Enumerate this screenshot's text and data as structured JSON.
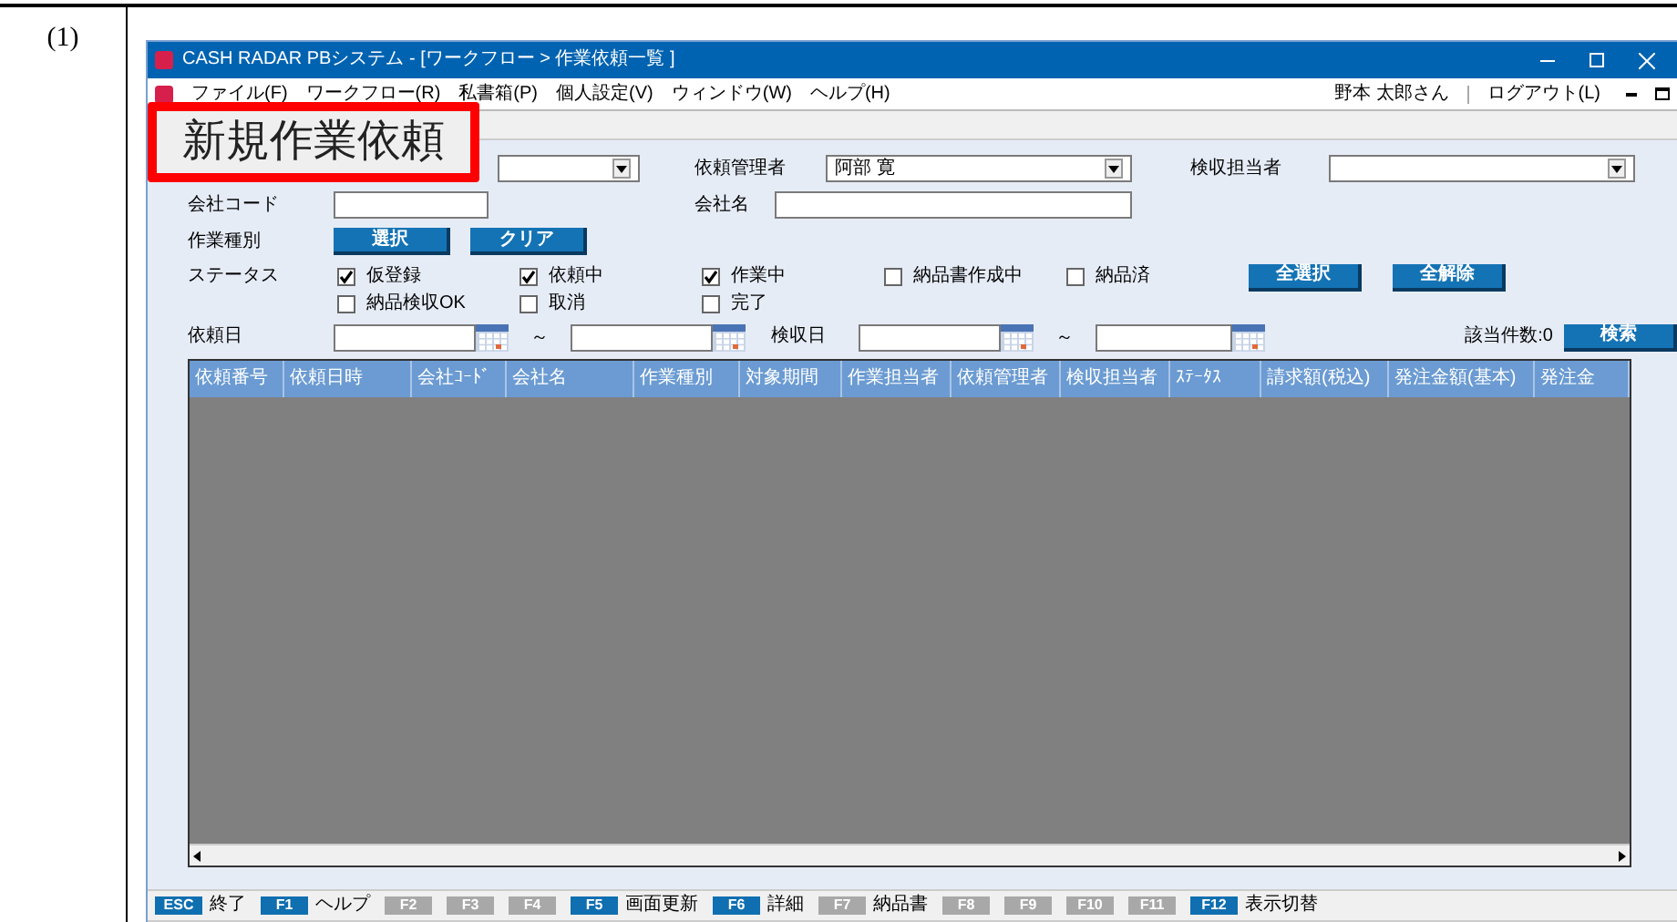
{
  "item_number": "(1)",
  "window": {
    "title": "CASH RADAR PBシステム - [ワークフロー > 作業依頼一覧 ]"
  },
  "menu": [
    {
      "label": "ファイル(F)"
    },
    {
      "label": "ワークフロー(R)"
    },
    {
      "label": "私書箱(P)"
    },
    {
      "label": "個人設定(V)"
    },
    {
      "label": "ウィンドウ(W)"
    },
    {
      "label": "ヘルプ(H)"
    }
  ],
  "user": {
    "name": "野本 太郎さん",
    "logout": "ログアウト(L)"
  },
  "callout": "新規作業依頼",
  "filters": {
    "manager_label": "依頼管理者",
    "manager_value": "阿部 寛",
    "inspector_label": "検収担当者",
    "company_code_label": "会社コード",
    "company_name_label": "会社名",
    "work_type_label": "作業種別",
    "select_button": "選択",
    "clear_button": "クリア",
    "status_label": "ステータス",
    "select_all": "全選択",
    "deselect_all": "全解除",
    "request_date_label": "依頼日",
    "inspect_date_label": "検収日",
    "tilde": "～",
    "tilde2": "～",
    "count": "該当件数:0",
    "search_button": "検索"
  },
  "statuses": [
    {
      "label": "仮登録",
      "checked": true
    },
    {
      "label": "依頼中",
      "checked": true
    },
    {
      "label": "作業中",
      "checked": true
    },
    {
      "label": "納品書作成中",
      "checked": false
    },
    {
      "label": "納品済",
      "checked": false
    },
    {
      "label": "納品検収OK",
      "checked": false
    },
    {
      "label": "取消",
      "checked": false
    },
    {
      "label": "完了",
      "checked": false
    }
  ],
  "table": {
    "columns": [
      "依頼番号",
      "依頼日時",
      "会社ｺｰﾄﾞ",
      "会社名",
      "作業種別",
      "対象期間",
      "作業担当者",
      "依頼管理者",
      "検収担当者",
      "ｽﾃｰﾀｽ",
      "請求額(税込)",
      "発注金額(基本)",
      "発注金"
    ]
  },
  "function_keys": [
    {
      "key": "ESC",
      "label": "終了",
      "enabled": true
    },
    {
      "key": "F1",
      "label": "ヘルプ",
      "enabled": true
    },
    {
      "key": "F2",
      "enabled": false
    },
    {
      "key": "F3",
      "enabled": false
    },
    {
      "key": "F4",
      "enabled": false
    },
    {
      "key": "F5",
      "label": "画面更新",
      "enabled": true
    },
    {
      "key": "F6",
      "label": "詳細",
      "enabled": true
    },
    {
      "key": "F7",
      "label": "納品書",
      "enabled": false
    },
    {
      "key": "F8",
      "enabled": false
    },
    {
      "key": "F9",
      "enabled": false
    },
    {
      "key": "F10",
      "enabled": false
    },
    {
      "key": "F11",
      "enabled": false
    },
    {
      "key": "F12",
      "label": "表示切替",
      "enabled": true
    }
  ]
}
